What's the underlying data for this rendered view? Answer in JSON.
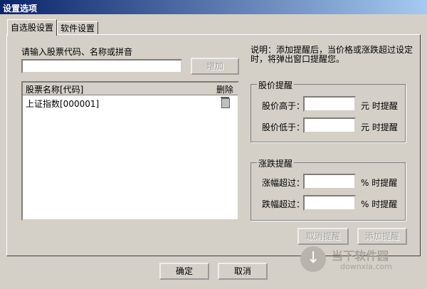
{
  "window": {
    "title": "设置选项"
  },
  "tabs": [
    {
      "label": "自选股设置",
      "active": true
    },
    {
      "label": "软件设置",
      "active": false
    }
  ],
  "stock_input": {
    "prompt": "请输入股票代码、名称或拼音",
    "value": "",
    "add_label": "增加"
  },
  "stock_list": {
    "headers": {
      "name": "股票名称[代码]",
      "delete": "删除"
    },
    "rows": [
      {
        "name": "上证指数[000001]"
      }
    ]
  },
  "description": "说明：添加提醒后，当价格或涨跌超过设定时，将弹出窗口提醒您。",
  "price_alert": {
    "title": "股价提醒",
    "above_label": "股价高于：",
    "above_value": "",
    "above_unit": "元 时提醒",
    "below_label": "股价低于：",
    "below_value": "",
    "below_unit": "元 时提醒"
  },
  "change_alert": {
    "title": "涨跌提醒",
    "rise_label": "涨幅超过：",
    "rise_value": "",
    "rise_unit": "% 时提醒",
    "fall_label": "跌幅超过：",
    "fall_value": "",
    "fall_unit": "% 时提醒"
  },
  "alert_buttons": {
    "cancel": "取消提醒",
    "add": "添加提醒"
  },
  "footer": {
    "ok": "确定",
    "cancel": "取消"
  },
  "watermark": {
    "title": "当下软件园",
    "url": "downxia.com"
  }
}
